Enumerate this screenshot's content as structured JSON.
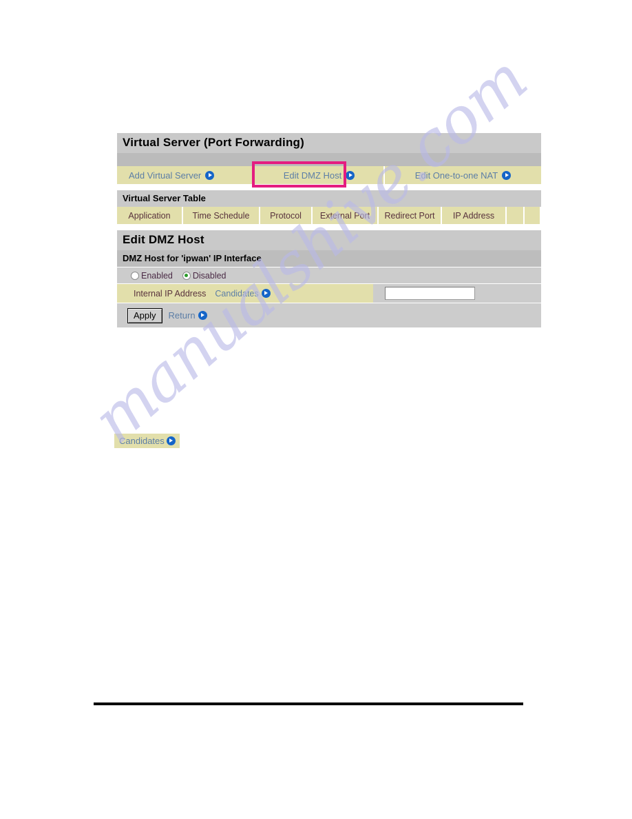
{
  "page": {
    "title": "Virtual Server (Port Forwarding)"
  },
  "tabs": [
    {
      "label": "Add Virtual Server",
      "icon": "play-arrow-icon",
      "highlighted": false
    },
    {
      "label": "Edit DMZ Host",
      "icon": "play-arrow-icon",
      "highlighted": true
    },
    {
      "label": "Edit One-to-one NAT",
      "icon": "play-arrow-icon",
      "highlighted": false
    }
  ],
  "virtual_server_table": {
    "title": "Virtual Server Table",
    "columns": [
      "Application",
      "Time Schedule",
      "Protocol",
      "External Port",
      "Redirect Port",
      "IP Address",
      "",
      ""
    ],
    "rows": []
  },
  "edit_dmz_host": {
    "title": "Edit DMZ Host",
    "subtitle": "DMZ Host for 'ipwan' IP Interface",
    "radios": [
      {
        "label": "Enabled",
        "checked": false
      },
      {
        "label": "Disabled",
        "checked": true
      }
    ],
    "internal_ip": {
      "label": "Internal IP Address",
      "candidates_label": "Candidates",
      "candidates_icon": "play-arrow-icon",
      "value": "",
      "placeholder": ""
    },
    "actions": {
      "apply_label": "Apply",
      "return_label": "Return",
      "return_icon": "play-arrow-icon"
    }
  },
  "candidates_chip": {
    "label": "Candidates",
    "icon": "play-arrow-icon"
  },
  "watermark": {
    "text": "manualshive.com"
  },
  "colors": {
    "highlight_pink": "#e41d80",
    "tab_khaki": "#e2dfab",
    "bar_gray": "#c9c9c9",
    "link_blue": "#5c7ea6",
    "icon_blue": "#1565c8",
    "radio_green": "#2a9a2a",
    "label_maroon": "#58323c"
  }
}
